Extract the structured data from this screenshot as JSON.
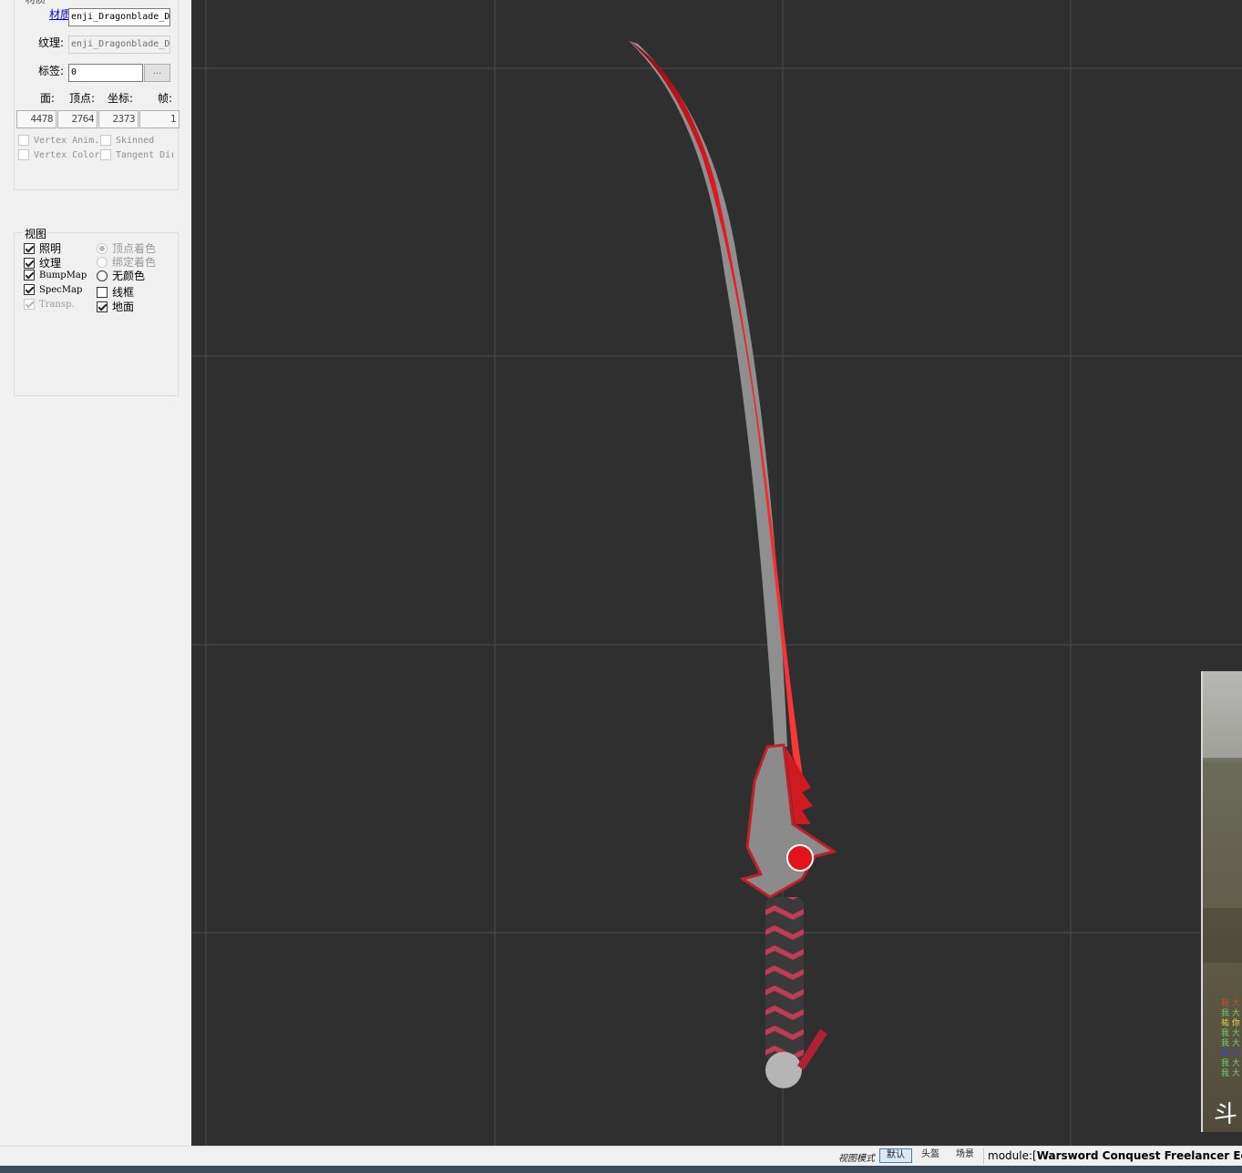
{
  "mesh_panel": {
    "title": "材质",
    "material_label": "材质:",
    "material_value": "enji_Dragonblade_D",
    "texture_label": "纹理:",
    "texture_value": "enji_Dragonblade_D",
    "tag_label": "标签:",
    "tag_value": "0",
    "tag_button": "...",
    "stats": [
      {
        "label": "面:",
        "value": "4478"
      },
      {
        "label": "顶点:",
        "value": "2764"
      },
      {
        "label": "坐标:",
        "value": "2373"
      },
      {
        "label": "帧:",
        "value": "1"
      }
    ],
    "flags": [
      {
        "label": "Vertex Anim.",
        "checked": false
      },
      {
        "label": "Skinned",
        "checked": false
      },
      {
        "label": "Vertex Color",
        "checked": false
      },
      {
        "label": "Tangent Dir",
        "checked": false
      }
    ]
  },
  "view_panel": {
    "title": "视图",
    "left_options": [
      {
        "label": "照明",
        "checked": true
      },
      {
        "label": "纹理",
        "checked": true
      },
      {
        "label": "BumpMap",
        "checked": true
      },
      {
        "label": "SpecMap",
        "checked": true
      },
      {
        "label": "Transp.",
        "checked": true,
        "disabled": true
      }
    ],
    "right_options": [
      {
        "label": "顶点着色",
        "type": "radio",
        "selected": true,
        "disabled": true
      },
      {
        "label": "绑定着色",
        "type": "radio",
        "selected": false,
        "disabled": true
      },
      {
        "label": "无颜色",
        "type": "radio",
        "selected": false
      },
      {
        "label": "线框",
        "type": "checkbox",
        "checked": false
      },
      {
        "label": "地面",
        "type": "checkbox",
        "checked": true
      }
    ]
  },
  "viewport": {
    "background": "#2f2f2f",
    "grid_color": "#4a4a4a",
    "blade_color": "#d8141f",
    "thumbnail_caption": "斗",
    "thumbnail_log": [
      {
        "text": "我 大",
        "color": "#d04a2a"
      },
      {
        "text": "我 大",
        "color": "#6fd06f"
      },
      {
        "text": "祐 你",
        "color": "#e8e040"
      },
      {
        "text": "我 大",
        "color": "#6fd06f"
      },
      {
        "text": "我 大",
        "color": "#6fd06f"
      },
      {
        "text": "我 大",
        "color": "#3a3af0"
      },
      {
        "text": "我 大",
        "color": "#6fd06f"
      },
      {
        "text": "我 大",
        "color": "#6fd06f"
      }
    ]
  },
  "statusbar": {
    "view_mode_label": "视图模式",
    "modes": [
      "默认",
      "头盔",
      "场景"
    ],
    "active_mode": "默认",
    "module_prefix": "module:[",
    "module_name": "Warsword Conquest Freelancer Editio"
  }
}
